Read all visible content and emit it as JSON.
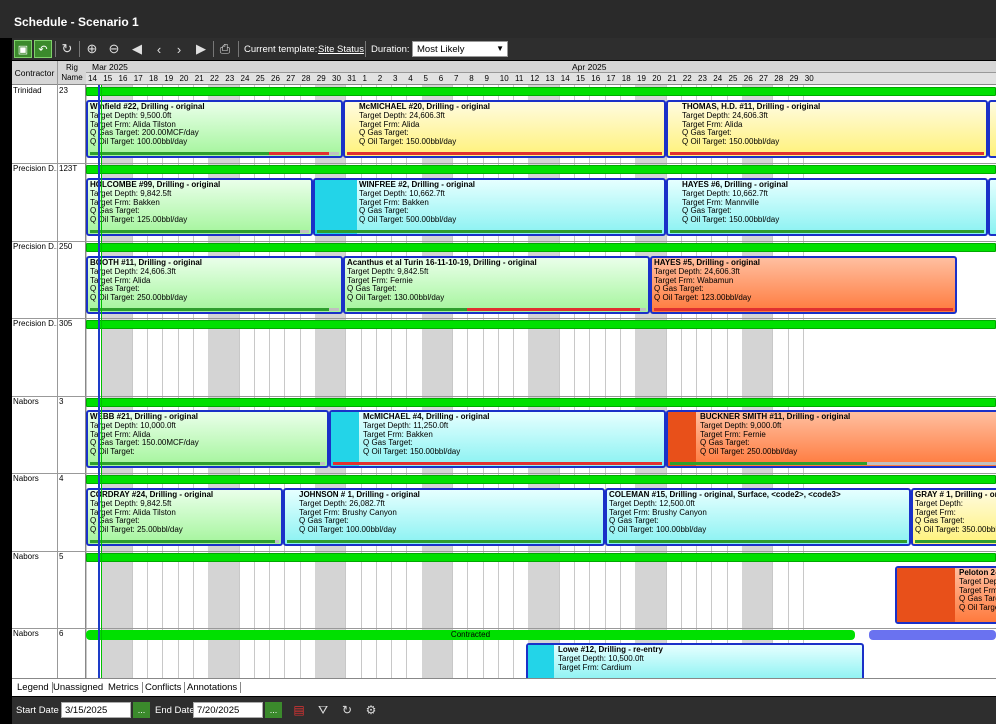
{
  "window": {
    "title": "Schedule - Scenario 1"
  },
  "toolbar": {
    "template_label": "Current template:",
    "template_value": "Site Status",
    "duration_label": "Duration:",
    "duration_value": "Most Likely",
    "icons": [
      "save-icon",
      "undo-icon",
      "refresh-icon",
      "zoom-in-icon",
      "zoom-out-icon",
      "first-icon",
      "prev-icon",
      "next-icon",
      "last-icon",
      "print-icon"
    ]
  },
  "header": {
    "contractor": "Contractor",
    "rig_name": "Rig Name",
    "months": [
      "Mar 2025",
      "Apr 2025"
    ],
    "days_mar": [
      "14",
      "15",
      "16",
      "17",
      "18",
      "19",
      "20",
      "21",
      "22",
      "23",
      "24",
      "25",
      "26",
      "27",
      "28",
      "29",
      "30",
      "31"
    ],
    "days_apr": [
      "1",
      "2",
      "3",
      "4",
      "5",
      "6",
      "7",
      "8",
      "9",
      "10",
      "11",
      "12",
      "13",
      "14",
      "15",
      "16",
      "17",
      "18",
      "19",
      "20",
      "21",
      "22",
      "23",
      "24",
      "25",
      "26",
      "27",
      "28",
      "29",
      "30"
    ]
  },
  "rows": [
    {
      "contractor": "Trinidad",
      "rig": "23"
    },
    {
      "contractor": "Precision D...",
      "rig": "123T"
    },
    {
      "contractor": "Precision D...",
      "rig": "250"
    },
    {
      "contractor": "Precision D...",
      "rig": "305"
    },
    {
      "contractor": "Nabors",
      "rig": "3"
    },
    {
      "contractor": "Nabors",
      "rig": "4"
    },
    {
      "contractor": "Nabors",
      "rig": "5"
    },
    {
      "contractor": "Nabors",
      "rig": "6"
    }
  ],
  "cards": [
    {
      "title": "Winfield #22, Drilling - original",
      "lines": [
        "Target Depth: 9,500.0ft",
        "Target Frm: Alida Tilston",
        "Q Gas Target: 200.00MCF/day",
        "Q Oil Target: 100.00bbl/day"
      ]
    },
    {
      "title": "McMICHAEL #20, Drilling - original",
      "lines": [
        "Target Depth: 24,606.3ft",
        "Target Frm: Alida",
        "Q Gas Target:",
        "Q Oil Target: 150.00bbl/day"
      ]
    },
    {
      "title": "THOMAS, H.D. #11, Drilling - original",
      "lines": [
        "Target Depth: 24,606.3ft",
        "Target Frm: Alida",
        "Q Gas Target:",
        "Q Oil Target: 150.00bbl/day"
      ]
    },
    {
      "title": "HOLCOMBE #99, Drilling - original",
      "lines": [
        "Target Depth: 9,842.5ft",
        "Target Frm: Bakken",
        "Q Gas Target:",
        "Q Oil Target: 125.00bbl/day"
      ]
    },
    {
      "title": "WINFREE #2, Drilling - original",
      "lines": [
        "Target Depth: 10,662.7ft",
        "Target Frm: Bakken",
        "Q Gas Target:",
        "Q Oil Target: 500.00bbl/day"
      ]
    },
    {
      "title": "HAYES #6, Drilling - original",
      "lines": [
        "Target Depth: 10,662.7ft",
        "Target Frm: Mannville",
        "Q Gas Target:",
        "Q Oil Target: 150.00bbl/day"
      ]
    },
    {
      "title": "BOOTH #11, Drilling - original",
      "lines": [
        "Target Depth: 24,606.3ft",
        "Target Frm: Alida",
        "Q Gas Target:",
        "Q Oil Target: 250.00bbl/day"
      ]
    },
    {
      "title": "Acanthus et al Turin 16-11-10-19, Drilling - original",
      "lines": [
        "Target Depth: 9,842.5ft",
        "Target Frm: Fernie",
        "Q Gas Target:",
        "Q Oil Target: 130.00bbl/day"
      ]
    },
    {
      "title": "HAYES #5, Drilling - original",
      "lines": [
        "Target Depth: 24,606.3ft",
        "Target Frm: Wabamun",
        "Q Gas Target:",
        "Q Oil Target: 123.00bbl/day"
      ]
    },
    {
      "title": "WEBB #21, Drilling - original",
      "lines": [
        "Target Depth: 10,000.0ft",
        "Target Frm: Alida",
        "Q Gas Target: 150.00MCF/day",
        "Q Oil Target:"
      ]
    },
    {
      "title": "McMICHAEL #4, Drilling - original",
      "lines": [
        "Target Depth: 11,250.0ft",
        "Target Frm: Bakken",
        "Q Gas Target:",
        "Q Oil Target: 150.00bbl/day"
      ]
    },
    {
      "title": "BUCKNER SMITH #11, Drilling - original",
      "lines": [
        "Target Depth: 9,000.0ft",
        "Target Frm: Fernie",
        "Q Gas Target:",
        "Q Oil Target: 250.00bbl/day"
      ]
    },
    {
      "title": "CORDRAY #24, Drilling - original",
      "lines": [
        "Target Depth: 9,842.5ft",
        "Target Frm: Alida Tilston",
        "Q Gas Target:",
        "Q Oil Target: 25.00bbl/day"
      ]
    },
    {
      "title": "JOHNSON # 1, Drilling - original",
      "lines": [
        "Target Depth: 26,082.7ft",
        "Target Frm: Brushy Canyon",
        "Q Gas Target:",
        "Q Oil Target: 100.00bbl/day"
      ]
    },
    {
      "title": "COLEMAN #15, Drilling - original, Surface, <code2>, <code3>",
      "lines": [
        "Target Depth: 12,500.0ft",
        "Target Frm: Brushy Canyon",
        "Q Gas Target:",
        "Q Oil Target: 100.00bbl/day"
      ]
    },
    {
      "title": "GRAY # 1, Drilling - orig",
      "lines": [
        "Target Depth:",
        "Target Frm:",
        "Q Gas Target:",
        "Q Oil Target: 350.00bbl"
      ]
    },
    {
      "title": "Peloton 2-3",
      "lines": [
        "Target Dept",
        "Target Frm",
        "Q Gas Targ",
        "Q Oil Targe"
      ]
    },
    {
      "title": "Lowe #12, Drilling - re-entry",
      "lines": [
        "Target Depth: 10,500.0ft",
        "Target Frm: Cardium"
      ]
    }
  ],
  "contracted_label": "Contracted",
  "tabs": [
    "Legend",
    "Unassigned",
    "Metrics",
    "Conflicts",
    "Annotations"
  ],
  "bottom": {
    "start_label": "Start Date",
    "start_value": "3/15/2025",
    "end_label": "End Date",
    "end_value": "7/20/2025",
    "button_text": "..."
  }
}
